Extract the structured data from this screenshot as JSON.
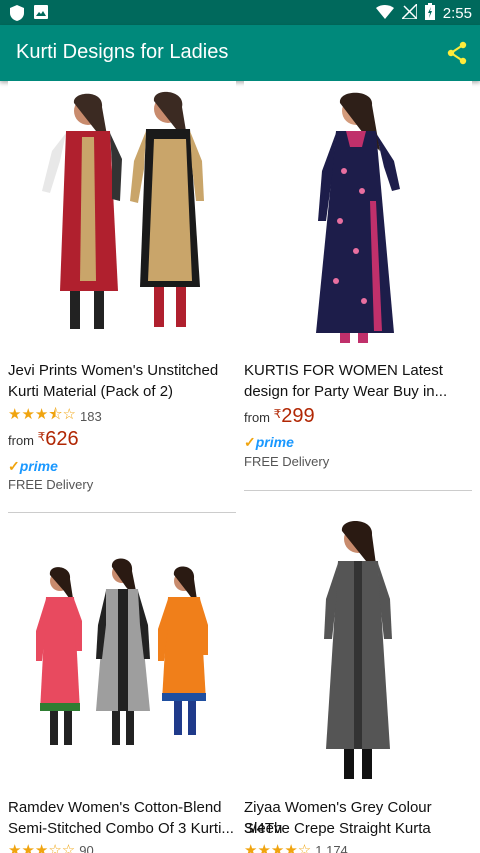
{
  "statusbar": {
    "time": "2:55"
  },
  "appbar": {
    "title": "Kurti Designs for Ladies"
  },
  "products": [
    {
      "name_line1": "Jevi Prints Women's Unstitched",
      "name_line2": "Kurti Material (Pack of 2)",
      "rating": 3.5,
      "review_count": "183",
      "from_label": "from",
      "currency": "₹",
      "price": "626",
      "prime_label": "prime",
      "delivery": "FREE Delivery"
    },
    {
      "name_line1": "KURTIS FOR WOMEN Latest",
      "name_line2": "design for Party Wear Buy in...",
      "from_label": "from",
      "currency": "₹",
      "price": "299",
      "prime_label": "prime",
      "delivery": "FREE Delivery"
    },
    {
      "name_line1": "Ramdev Women's Cotton-Blend",
      "name_line2": "Semi-Stitched Combo Of 3 Kurti...",
      "rating": 3,
      "review_count": "90"
    },
    {
      "name_line1": "Ziyaa Women's Grey Colour 3/4Th",
      "name_line2": "Sleeve Crepe Straight Kurta",
      "rating": 4,
      "review_count": "1,174"
    }
  ],
  "colors": {
    "statusbar": "#00695c",
    "appbar": "#00897b",
    "share": "#ffeb3b",
    "price": "#b12704",
    "star": "#f0a40f",
    "prime": "#1a98ff"
  }
}
